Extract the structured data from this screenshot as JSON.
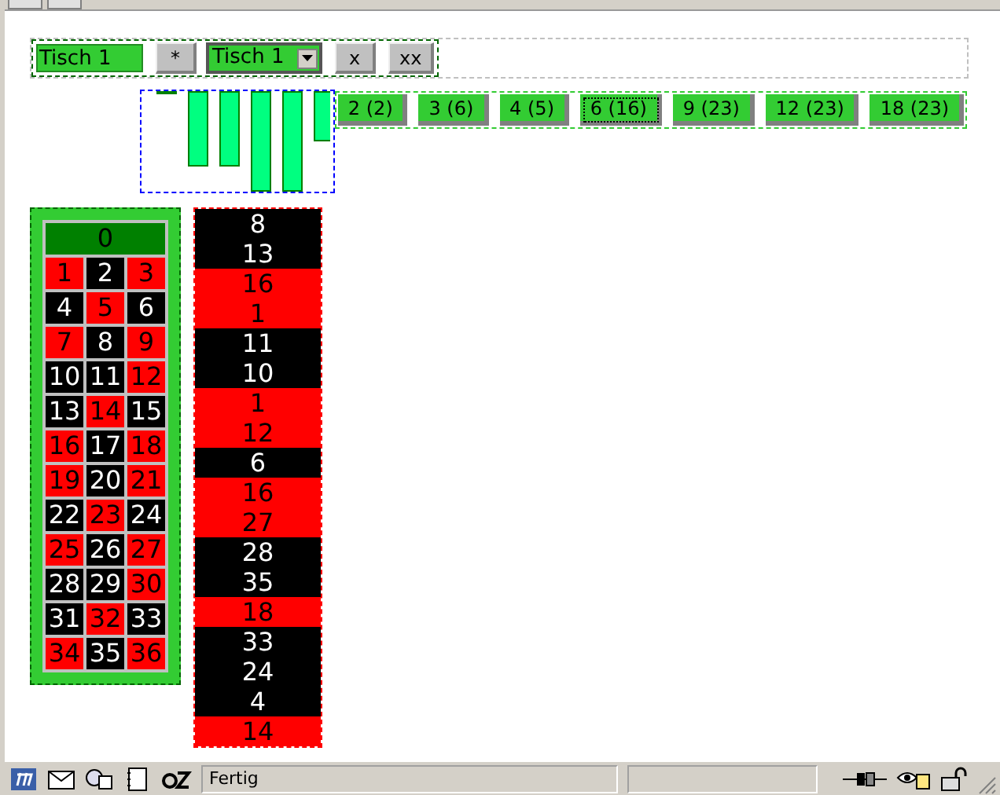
{
  "table_field": {
    "value": "Tisch 1"
  },
  "add_button": {
    "label": "*"
  },
  "table_select": {
    "value": "Tisch 1"
  },
  "remove_button": {
    "label": "x"
  },
  "remove_all_button": {
    "label": "xx"
  },
  "interval_buttons": [
    {
      "label": "2 (2)",
      "selected": false
    },
    {
      "label": "3 (6)",
      "selected": false
    },
    {
      "label": "4 (5)",
      "selected": false
    },
    {
      "label": "6 (16)",
      "selected": true
    },
    {
      "label": "9 (23)",
      "selected": false
    },
    {
      "label": "12 (23)",
      "selected": false
    },
    {
      "label": "18 (23)",
      "selected": false
    }
  ],
  "board": {
    "zero": "0",
    "numbers": [
      {
        "label": "1",
        "color": "#ff0000"
      },
      {
        "label": "2",
        "color": "#000000"
      },
      {
        "label": "3",
        "color": "#ff0000"
      },
      {
        "label": "4",
        "color": "#000000"
      },
      {
        "label": "5",
        "color": "#ff0000"
      },
      {
        "label": "6",
        "color": "#000000"
      },
      {
        "label": "7",
        "color": "#ff0000"
      },
      {
        "label": "8",
        "color": "#000000"
      },
      {
        "label": "9",
        "color": "#ff0000"
      },
      {
        "label": "10",
        "color": "#000000"
      },
      {
        "label": "11",
        "color": "#000000"
      },
      {
        "label": "12",
        "color": "#ff0000"
      },
      {
        "label": "13",
        "color": "#000000"
      },
      {
        "label": "14",
        "color": "#ff0000"
      },
      {
        "label": "15",
        "color": "#000000"
      },
      {
        "label": "16",
        "color": "#ff0000"
      },
      {
        "label": "17",
        "color": "#000000"
      },
      {
        "label": "18",
        "color": "#ff0000"
      },
      {
        "label": "19",
        "color": "#ff0000"
      },
      {
        "label": "20",
        "color": "#000000"
      },
      {
        "label": "21",
        "color": "#ff0000"
      },
      {
        "label": "22",
        "color": "#000000"
      },
      {
        "label": "23",
        "color": "#ff0000"
      },
      {
        "label": "24",
        "color": "#000000"
      },
      {
        "label": "25",
        "color": "#ff0000"
      },
      {
        "label": "26",
        "color": "#000000"
      },
      {
        "label": "27",
        "color": "#ff0000"
      },
      {
        "label": "28",
        "color": "#000000"
      },
      {
        "label": "29",
        "color": "#000000"
      },
      {
        "label": "30",
        "color": "#ff0000"
      },
      {
        "label": "31",
        "color": "#000000"
      },
      {
        "label": "32",
        "color": "#ff0000"
      },
      {
        "label": "33",
        "color": "#000000"
      },
      {
        "label": "34",
        "color": "#ff0000"
      },
      {
        "label": "35",
        "color": "#000000"
      },
      {
        "label": "36",
        "color": "#ff0000"
      }
    ]
  },
  "history": [
    {
      "label": "8",
      "color": "#000000"
    },
    {
      "label": "13",
      "color": "#000000"
    },
    {
      "label": "16",
      "color": "#ff0000"
    },
    {
      "label": "1",
      "color": "#ff0000"
    },
    {
      "label": "11",
      "color": "#000000"
    },
    {
      "label": "10",
      "color": "#000000"
    },
    {
      "label": "1",
      "color": "#ff0000"
    },
    {
      "label": "12",
      "color": "#ff0000"
    },
    {
      "label": "6",
      "color": "#000000"
    },
    {
      "label": "16",
      "color": "#ff0000"
    },
    {
      "label": "27",
      "color": "#ff0000"
    },
    {
      "label": "28",
      "color": "#000000"
    },
    {
      "label": "35",
      "color": "#000000"
    },
    {
      "label": "18",
      "color": "#ff0000"
    },
    {
      "label": "33",
      "color": "#000000"
    },
    {
      "label": "24",
      "color": "#000000"
    },
    {
      "label": "4",
      "color": "#000000"
    },
    {
      "label": "14",
      "color": "#ff0000"
    }
  ],
  "status_bar": {
    "text": "Fertig"
  }
}
